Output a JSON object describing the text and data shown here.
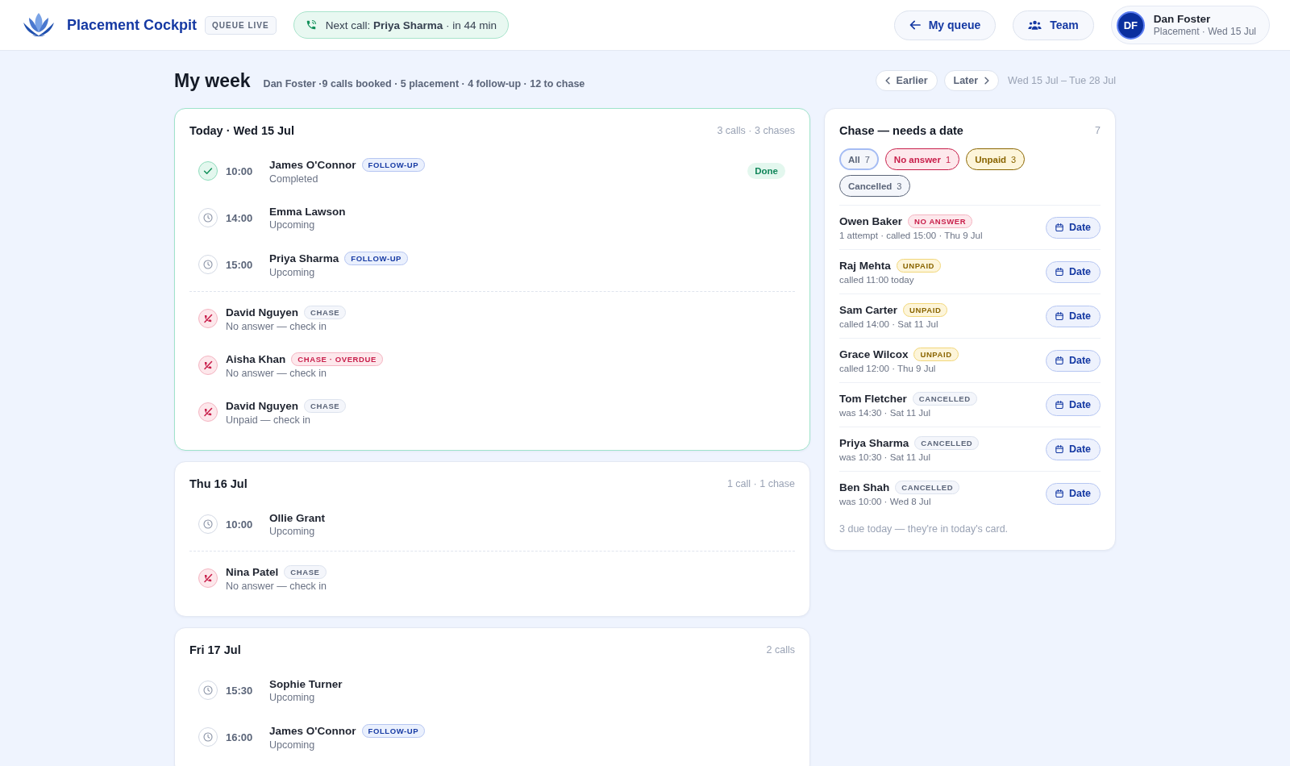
{
  "header": {
    "app_title": "Placement Cockpit",
    "live_badge": "QUEUE LIVE",
    "next_call": "Next call: **Priya Sharma** · in 44 min",
    "nav_buttons": [
      {
        "label": "My queue",
        "kind": "back"
      },
      {
        "label": "Team",
        "kind": "team"
      }
    ],
    "user": {
      "initials": "DF",
      "name": "Dan Foster",
      "role": "Placement · Wed 15 Jul"
    }
  },
  "page": {
    "title": "My week",
    "summary": "Dan Foster ·9 calls booked · 5 placement · 4 follow-up · 12 to chase",
    "pager": [
      {
        "label": "Earlier",
        "kind": "prev"
      },
      {
        "label": "Later",
        "kind": "next"
      }
    ],
    "range": "Wed 15 Jul – Tue 28 Jul"
  },
  "days": [
    {
      "title": "Today · Wed 15 Jul",
      "summary": "3 calls · 3 chases",
      "today": true,
      "calls": [
        {
          "time": "10:00",
          "name": "James O'Connor",
          "tag": "FOLLOW-UP",
          "status": "Completed",
          "done": true,
          "badge": "Done"
        },
        {
          "time": "14:00",
          "name": "Emma Lawson",
          "status": "Upcoming",
          "done": false
        },
        {
          "time": "15:00",
          "name": "Priya Sharma",
          "tag": "FOLLOW-UP",
          "status": "Upcoming",
          "done": false
        }
      ],
      "chases": [
        {
          "name": "David Nguyen",
          "tag": "CHASE",
          "overdue": false,
          "note": "No answer — check in"
        },
        {
          "name": "Aisha Khan",
          "tag": "CHASE · OVERDUE",
          "overdue": true,
          "note": "No answer — check in"
        },
        {
          "name": "David Nguyen",
          "tag": "CHASE",
          "overdue": false,
          "note": "Unpaid — check in"
        }
      ]
    },
    {
      "title": "Thu 16 Jul",
      "summary": "1 call · 1 chase",
      "today": false,
      "calls": [
        {
          "time": "10:00",
          "name": "Ollie Grant",
          "status": "Upcoming",
          "done": false
        }
      ],
      "chases": [
        {
          "name": "Nina Patel",
          "tag": "CHASE",
          "overdue": false,
          "note": "No answer — check in"
        }
      ]
    },
    {
      "title": "Fri 17 Jul",
      "summary": "2 calls",
      "today": false,
      "calls": [
        {
          "time": "15:30",
          "name": "Sophie Turner",
          "status": "Upcoming",
          "done": false
        },
        {
          "time": "16:00",
          "name": "James O'Connor",
          "tag": "FOLLOW-UP",
          "status": "Upcoming",
          "done": false
        }
      ]
    }
  ],
  "chase_panel": {
    "title": "Chase — needs a date",
    "count": "7",
    "filters": [
      {
        "label": "All",
        "count": "7",
        "kind": "all",
        "selected": true
      },
      {
        "label": "No answer",
        "count": "1",
        "kind": "no_answer",
        "selected": false
      },
      {
        "label": "Unpaid",
        "count": "3",
        "kind": "unpaid",
        "selected": false
      },
      {
        "label": "Cancelled",
        "count": "3",
        "kind": "cancelled",
        "selected": false
      }
    ],
    "items": [
      {
        "name": "Owen Baker",
        "tag": "NO ANSWER",
        "kind": "no_answer",
        "detail": "1 attempt · called 15:00 · Thu 9 Jul",
        "action": "Date"
      },
      {
        "name": "Raj Mehta",
        "tag": "UNPAID",
        "kind": "unpaid",
        "detail": "called 11:00 today",
        "action": "Date"
      },
      {
        "name": "Sam Carter",
        "tag": "UNPAID",
        "kind": "unpaid",
        "detail": "called 14:00 · Sat 11 Jul",
        "action": "Date"
      },
      {
        "name": "Grace Wilcox",
        "tag": "UNPAID",
        "kind": "unpaid",
        "detail": "called 12:00 · Thu 9 Jul",
        "action": "Date"
      },
      {
        "name": "Tom Fletcher",
        "tag": "CANCELLED",
        "kind": "cancelled",
        "detail": "was 14:30 · Sat 11 Jul",
        "action": "Date"
      },
      {
        "name": "Priya Sharma",
        "tag": "CANCELLED",
        "kind": "cancelled",
        "detail": "was 10:30 · Sat 11 Jul",
        "action": "Date"
      },
      {
        "name": "Ben Shah",
        "tag": "CANCELLED",
        "kind": "cancelled",
        "detail": "was 10:00 · Wed 8 Jul",
        "action": "Date"
      }
    ],
    "footnote": "3 due today — they're in today's card."
  }
}
